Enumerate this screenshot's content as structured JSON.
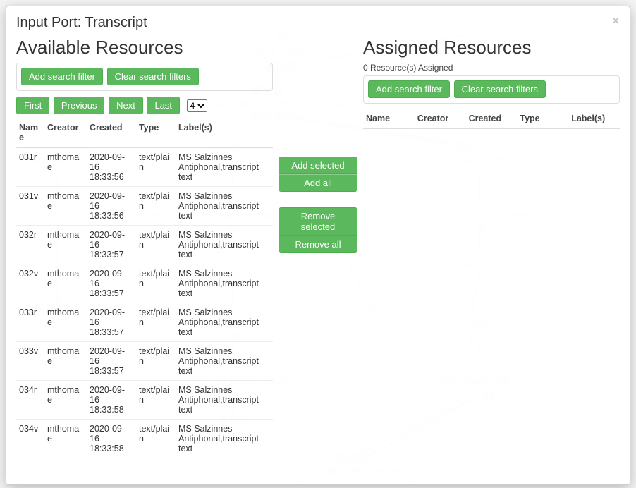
{
  "dialog": {
    "title": "Input Port: Transcript",
    "close_label": "×"
  },
  "available": {
    "heading": "Available Resources",
    "filter_add": "Add search filter",
    "filter_clear": "Clear search filters",
    "pager": {
      "first": "First",
      "previous": "Previous",
      "next": "Next",
      "last": "Last",
      "page_value": "4"
    },
    "columns": {
      "name": "Name",
      "creator": "Creator",
      "created": "Created",
      "type": "Type",
      "labels": "Label(s)"
    },
    "rows": [
      {
        "name": "031r",
        "creator": "mthomae",
        "created": "2020-09-16 18:33:56",
        "type": "text/plain",
        "labels": "MS Salzinnes Antiphonal,transcript text"
      },
      {
        "name": "031v",
        "creator": "mthomae",
        "created": "2020-09-16 18:33:56",
        "type": "text/plain",
        "labels": "MS Salzinnes Antiphonal,transcript text"
      },
      {
        "name": "032r",
        "creator": "mthomae",
        "created": "2020-09-16 18:33:57",
        "type": "text/plain",
        "labels": "MS Salzinnes Antiphonal,transcript text"
      },
      {
        "name": "032v",
        "creator": "mthomae",
        "created": "2020-09-16 18:33:57",
        "type": "text/plain",
        "labels": "MS Salzinnes Antiphonal,transcript text"
      },
      {
        "name": "033r",
        "creator": "mthomae",
        "created": "2020-09-16 18:33:57",
        "type": "text/plain",
        "labels": "MS Salzinnes Antiphonal,transcript text"
      },
      {
        "name": "033v",
        "creator": "mthomae",
        "created": "2020-09-16 18:33:57",
        "type": "text/plain",
        "labels": "MS Salzinnes Antiphonal,transcript text"
      },
      {
        "name": "034r",
        "creator": "mthomae",
        "created": "2020-09-16 18:33:58",
        "type": "text/plain",
        "labels": "MS Salzinnes Antiphonal,transcript text"
      },
      {
        "name": "034v",
        "creator": "mthomae",
        "created": "2020-09-16 18:33:58",
        "type": "text/plain",
        "labels": "MS Salzinnes Antiphonal,transcript text"
      }
    ]
  },
  "actions": {
    "add_selected": "Add selected",
    "add_all": "Add all",
    "remove_selected": "Remove selected",
    "remove_all": "Remove all"
  },
  "assigned": {
    "heading": "Assigned Resources",
    "count_text": "0 Resource(s) Assigned",
    "filter_add": "Add search filter",
    "filter_clear": "Clear search filters",
    "columns": {
      "name": "Name",
      "creator": "Creator",
      "created": "Created",
      "type": "Type",
      "labels": "Label(s)"
    }
  },
  "bg_nodes": {
    "resize_image": "Resize Image",
    "fast_pixel": "Fast Pixelwise Analysis of Music Document",
    "labeler1": "Labeler",
    "labeler2": "Labeler",
    "png_rgb1": "PNG (RGB)",
    "png_rgb2": "PNG (RGB)",
    "png_rgb3": "PNG (RGB)",
    "convert_bw1": "Convert to one-bit (black and white) PNG",
    "convert_bw2": "Convert to one-bit (black and white) PNG",
    "despeckle1": "Despeckle",
    "despeckle2": "Despeckle",
    "cc_analysis": "CC Analysis",
    "dilate": "Dilate",
    "diag_neume": "Diagonal Neume Slicing",
    "miyao": "Miyao Staff Finding",
    "non_interactive": "Non-Interactive Classifier",
    "heuristic": "Heuristic Pitch Finding"
  }
}
